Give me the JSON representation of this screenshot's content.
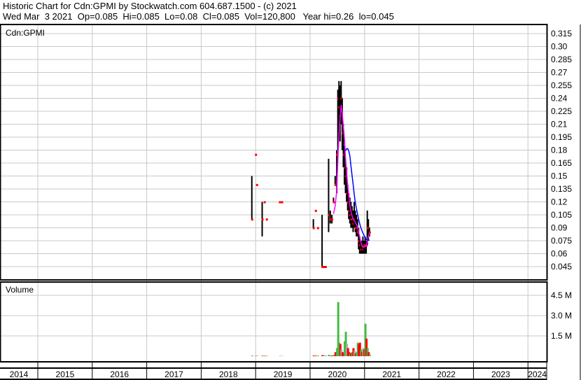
{
  "header": {
    "line1": "Historic Chart for Cdn:GPMI by Stockwatch.com 604.687.1500 - (c) 2021",
    "line2": "Wed Mar  3 2021  Op=0.085  Hi=0.085  Lo=0.08  Cl=0.085  Vol=120,800   Year hi=0.26  lo=0.045"
  },
  "chart_data": {
    "type": "line",
    "title": "Cdn:GPMI",
    "volume_label": "Volume",
    "price_ticks": [
      "0.045",
      "0.06",
      "0.075",
      "0.09",
      "0.105",
      "0.12",
      "0.135",
      "0.15",
      "0.165",
      "0.18",
      "0.195",
      "0.21",
      "0.225",
      "0.24",
      "0.255",
      "0.27",
      "0.285",
      "0.30",
      "0.315"
    ],
    "price_range": [
      0.045,
      0.315
    ],
    "volume_ticks": [
      {
        "v": 1.5,
        "label": "1.5 M"
      },
      {
        "v": 3.0,
        "label": "3.0 M"
      },
      {
        "v": 4.5,
        "label": "4.5 M"
      }
    ],
    "years": [
      "2014",
      "2015",
      "2016",
      "2017",
      "2018",
      "2019",
      "2020",
      "2021",
      "2022",
      "2023",
      "2024"
    ],
    "columns": [
      "year",
      "high",
      "low",
      "close",
      "volume_M",
      "direction"
    ],
    "bars": [
      [
        2018.93,
        0.15,
        0.1,
        0.1,
        0.05,
        "g"
      ],
      [
        2019.0,
        0.175,
        0.175,
        0.175,
        0.02,
        "r"
      ],
      [
        2019.02,
        0.14,
        0.14,
        0.14,
        0.02,
        "r"
      ],
      [
        2019.12,
        0.12,
        0.08,
        0.1,
        0.05,
        "g"
      ],
      [
        2019.16,
        0.12,
        0.12,
        0.12,
        0.03,
        "r"
      ],
      [
        2019.2,
        0.1,
        0.1,
        0.1,
        0.02,
        "r"
      ],
      [
        2019.44,
        0.12,
        0.12,
        0.12,
        0.02,
        "g"
      ],
      [
        2019.48,
        0.12,
        0.12,
        0.12,
        0.02,
        "g"
      ],
      [
        2020.06,
        0.1,
        0.09,
        0.09,
        0.05,
        "r"
      ],
      [
        2020.1,
        0.11,
        0.11,
        0.11,
        0.04,
        "r"
      ],
      [
        2020.14,
        0.09,
        0.09,
        0.09,
        0.04,
        "g"
      ],
      [
        2020.22,
        0.105,
        0.045,
        0.045,
        0.08,
        "r"
      ],
      [
        2020.25,
        0.045,
        0.045,
        0.045,
        0.06,
        "g"
      ],
      [
        2020.28,
        0.04,
        0.04,
        0.045,
        0.05,
        "k"
      ],
      [
        2020.34,
        0.17,
        0.085,
        0.105,
        0.1,
        "g"
      ],
      [
        2020.37,
        0.11,
        0.095,
        0.1,
        0.05,
        "g"
      ],
      [
        2020.4,
        0.105,
        0.095,
        0.1,
        0.05,
        "r"
      ],
      [
        2020.43,
        0.125,
        0.12,
        0.12,
        0.1,
        "g"
      ],
      [
        2020.46,
        0.15,
        0.14,
        0.14,
        0.3,
        "r"
      ],
      [
        2020.49,
        0.18,
        0.13,
        0.175,
        0.6,
        "g"
      ],
      [
        2020.51,
        0.25,
        0.18,
        0.24,
        4.0,
        "g"
      ],
      [
        2020.53,
        0.26,
        0.2,
        0.23,
        1.0,
        "g"
      ],
      [
        2020.55,
        0.255,
        0.19,
        0.22,
        0.9,
        "r"
      ],
      [
        2020.57,
        0.26,
        0.21,
        0.24,
        0.5,
        "k"
      ],
      [
        2020.59,
        0.24,
        0.18,
        0.2,
        0.3,
        "r"
      ],
      [
        2020.61,
        0.21,
        0.16,
        0.175,
        0.2,
        "r"
      ],
      [
        2020.63,
        0.185,
        0.14,
        0.16,
        1.1,
        "g"
      ],
      [
        2020.65,
        0.17,
        0.13,
        0.15,
        1.8,
        "g"
      ],
      [
        2020.67,
        0.16,
        0.12,
        0.13,
        0.9,
        "k"
      ],
      [
        2020.69,
        0.14,
        0.11,
        0.12,
        0.6,
        "r"
      ],
      [
        2020.71,
        0.13,
        0.1,
        0.11,
        0.3,
        "r"
      ],
      [
        2020.73,
        0.125,
        0.095,
        0.105,
        0.2,
        "g"
      ],
      [
        2020.75,
        0.12,
        0.09,
        0.1,
        0.25,
        "r"
      ],
      [
        2020.77,
        0.115,
        0.09,
        0.1,
        0.3,
        "g"
      ],
      [
        2020.79,
        0.11,
        0.085,
        0.095,
        0.6,
        "r"
      ],
      [
        2020.81,
        0.12,
        0.09,
        0.1,
        0.4,
        "k"
      ],
      [
        2020.83,
        0.11,
        0.085,
        0.09,
        0.2,
        "r"
      ],
      [
        2020.85,
        0.105,
        0.08,
        0.09,
        0.3,
        "g"
      ],
      [
        2020.87,
        0.1,
        0.08,
        0.085,
        1.0,
        "g"
      ],
      [
        2020.89,
        0.09,
        0.065,
        0.075,
        0.9,
        "r"
      ],
      [
        2020.91,
        0.08,
        0.06,
        0.07,
        1.0,
        "r"
      ],
      [
        2020.93,
        0.075,
        0.06,
        0.065,
        0.5,
        "g"
      ],
      [
        2020.95,
        0.075,
        0.06,
        0.07,
        0.3,
        "r"
      ],
      [
        2020.97,
        0.08,
        0.06,
        0.065,
        0.6,
        "k"
      ],
      [
        2020.99,
        0.075,
        0.06,
        0.07,
        0.5,
        "r"
      ],
      [
        2021.01,
        0.08,
        0.06,
        0.07,
        2.4,
        "g"
      ],
      [
        2021.03,
        0.075,
        0.06,
        0.07,
        1.3,
        "r"
      ],
      [
        2021.05,
        0.11,
        0.07,
        0.09,
        0.6,
        "g"
      ],
      [
        2021.07,
        0.1,
        0.075,
        0.09,
        0.3,
        "r"
      ],
      [
        2021.09,
        0.09,
        0.08,
        0.085,
        0.12,
        "g"
      ]
    ],
    "ma_short_color": "#ff00ff",
    "ma_long_color": "#0000ff",
    "up_color": "#44bb44",
    "down_color": "#ff0000"
  }
}
